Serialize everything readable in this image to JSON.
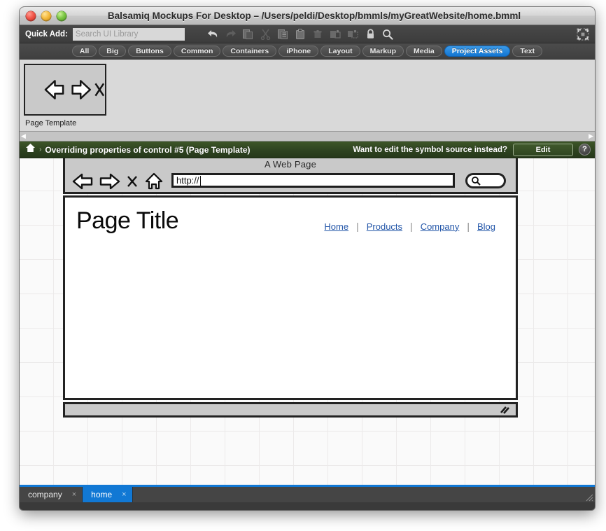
{
  "window": {
    "title": "Balsamiq Mockups For Desktop – /Users/peldi/Desktop/bmmls/myGreatWebsite/home.bmml",
    "close_label": "",
    "minimize_label": "",
    "zoom_label": ""
  },
  "toolbar": {
    "quick_add_label": "Quick Add:",
    "search_placeholder": "Search UI Library",
    "search_value": "",
    "icons": [
      {
        "name": "undo-icon",
        "title": "Undo"
      },
      {
        "name": "redo-icon",
        "title": "Redo"
      },
      {
        "name": "copy-icon",
        "title": "Copy"
      },
      {
        "name": "cut-icon",
        "title": "Cut"
      },
      {
        "name": "duplicate-icon",
        "title": "Duplicate"
      },
      {
        "name": "paste-icon",
        "title": "Paste"
      },
      {
        "name": "delete-icon",
        "title": "Delete"
      },
      {
        "name": "group-icon",
        "title": "Group"
      },
      {
        "name": "ungroup-icon",
        "title": "Ungroup"
      },
      {
        "name": "lock-icon",
        "title": "Lock"
      },
      {
        "name": "zoom-icon",
        "title": "Zoom"
      }
    ],
    "fullscreen_icon": "fullscreen-icon"
  },
  "categories": {
    "selected": "Project Assets",
    "tabs": [
      {
        "label": "All"
      },
      {
        "label": "Big"
      },
      {
        "label": "Buttons"
      },
      {
        "label": "Common"
      },
      {
        "label": "Containers"
      },
      {
        "label": "iPhone"
      },
      {
        "label": "Layout"
      },
      {
        "label": "Markup"
      },
      {
        "label": "Media"
      },
      {
        "label": "Project Assets"
      },
      {
        "label": "Text"
      }
    ],
    "accent_color": "#1275d2"
  },
  "assets": [
    {
      "label": "Page Template"
    }
  ],
  "asset_scrollbar": {
    "left_arrow": "◀",
    "right_arrow": "▶"
  },
  "override_bar": {
    "home_icon": "home-icon",
    "separator": "›",
    "message": "Overriding properties of control #5 (Page Template)",
    "question": "Want to edit the symbol source instead?",
    "edit_label": "Edit",
    "help_label": "?",
    "background_color": "#2e4320"
  },
  "mockup": {
    "browser_caption": "A Web Page",
    "back_icon": "back-arrow-icon",
    "forward_icon": "forward-arrow-icon",
    "stop_icon": "stop-x-icon",
    "home_icon": "home-house-icon",
    "url_value": "http://",
    "search_icon": "magnifier-icon",
    "page_title": "Page Title",
    "nav_divider": "|",
    "nav_links": [
      {
        "label": "Home"
      },
      {
        "label": "Products"
      },
      {
        "label": "Company"
      },
      {
        "label": "Blog"
      }
    ],
    "nav_link_color": "#2255a8",
    "resize_grip_icon": "resize-grip-icon"
  },
  "page_tabs": {
    "accent_color": "#1178d4",
    "close_label": "×",
    "tabs": [
      {
        "label": "company",
        "active": false
      },
      {
        "label": "home",
        "active": true
      }
    ]
  }
}
